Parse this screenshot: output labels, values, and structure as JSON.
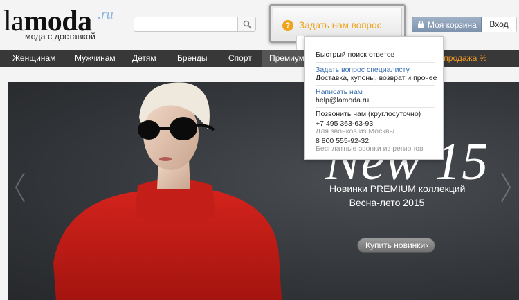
{
  "header": {
    "logo": {
      "main_la": "la",
      "main_moda": "moda",
      "suffix": ".ru",
      "tagline": "мода с доставкой"
    },
    "search": {
      "value": "",
      "placeholder": "",
      "button_icon": "search-icon"
    },
    "ask_question": {
      "label": "Задать нам вопрос",
      "icon": "question-icon",
      "icon_glyph": "?",
      "accent": "#f0a21c"
    },
    "cart": {
      "label": "Моя корзина",
      "icon": "bag-icon"
    },
    "login": {
      "label": "Вход"
    }
  },
  "nav": {
    "items": [
      {
        "label": "Женщинам"
      },
      {
        "label": "Мужчинам"
      },
      {
        "label": "Детям"
      },
      {
        "label": "Бренды"
      },
      {
        "label": "Спорт"
      },
      {
        "label": "Премиум"
      },
      {
        "label": "Распродажа %"
      }
    ],
    "sale_color": "#f39a25"
  },
  "help_dropdown": {
    "quick_search": "Быстрый поиск ответов",
    "ask_specialist": "Задать вопрос специалисту",
    "ask_specialist_desc": "Доставка, купоны, возврат и прочее",
    "write_us": "Написать нам",
    "email": "help@lamoda.ru",
    "call_us": "Позвонить нам (круглосуточно)",
    "phone_moscow": "+7 495 363-63-93",
    "phone_moscow_note": "Для звонков из Москвы",
    "phone_regions": "8 800 555-92-32",
    "phone_regions_note": "Бесплатные звонки из регионов",
    "link_color": "#3a6fb0"
  },
  "banner": {
    "headline": "New 15",
    "subtitle_line1": "Новинки PREMIUM коллекций",
    "subtitle_line2": "Весна-лето 2015",
    "cta_label": "Купить новинки",
    "cta_icon": "chevron-right-icon",
    "cta_glyph": "›",
    "prev_icon": "chevron-left-icon",
    "next_icon": "chevron-right-icon"
  }
}
